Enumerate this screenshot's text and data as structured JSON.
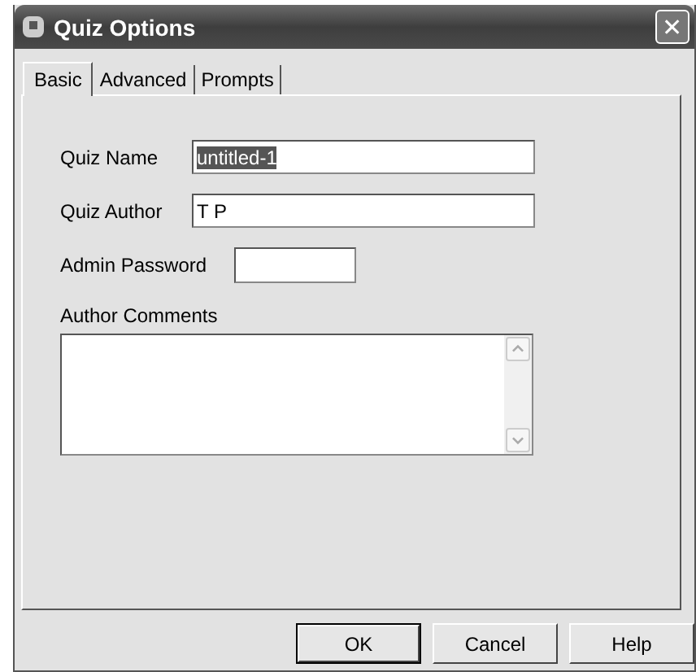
{
  "window": {
    "title": "Quiz Options",
    "close_icon": "✕"
  },
  "tabs": [
    {
      "label": "Basic",
      "selected": true
    },
    {
      "label": "Advanced",
      "selected": false
    },
    {
      "label": "Prompts",
      "selected": false
    }
  ],
  "fields": [
    {
      "kind": "text",
      "label": "Quiz Name",
      "value": "untitled-1",
      "value_selected": true
    },
    {
      "kind": "text",
      "label": "Quiz Author",
      "value": "T P",
      "value_selected": false
    },
    {
      "kind": "password",
      "label": "Admin Password"
    },
    {
      "kind": "textarea",
      "label": "Author Comments"
    }
  ],
  "buttons": [
    {
      "label": "OK",
      "default": true
    },
    {
      "label": "Cancel",
      "default": false
    },
    {
      "label": "Help",
      "default": false
    }
  ]
}
